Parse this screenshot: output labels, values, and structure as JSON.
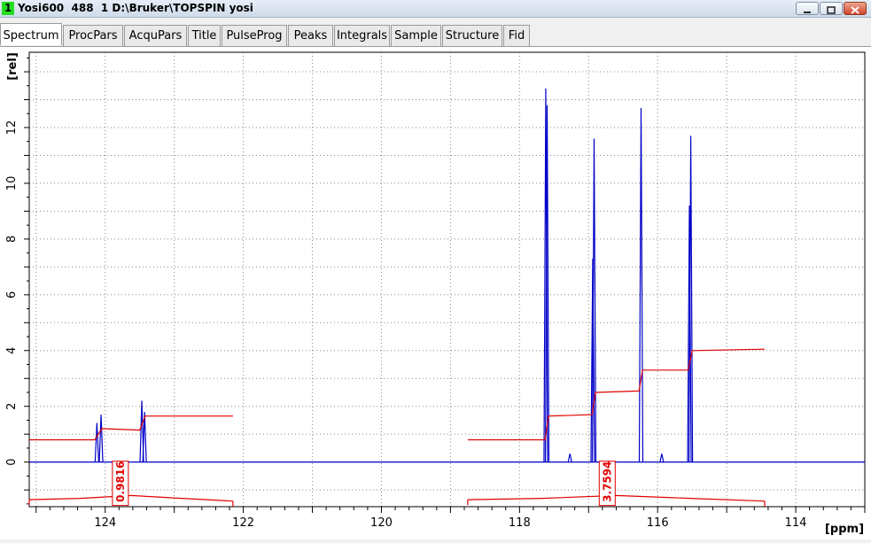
{
  "window": {
    "number": "1",
    "title": "Yosi600  488  1 D:\\Bruker\\TOPSPIN yosi"
  },
  "tabs": [
    {
      "label": "Spectrum",
      "active": true
    },
    {
      "label": "ProcPars",
      "active": false
    },
    {
      "label": "AcquPars",
      "active": false
    },
    {
      "label": "Title",
      "active": false
    },
    {
      "label": "PulseProg",
      "active": false
    },
    {
      "label": "Peaks",
      "active": false
    },
    {
      "label": "Integrals",
      "active": false
    },
    {
      "label": "Sample",
      "active": false
    },
    {
      "label": "Structure",
      "active": false
    },
    {
      "label": "Fid",
      "active": false
    }
  ],
  "colors": {
    "spectrum": "#0000c8",
    "integral": "#e00000",
    "grid": "#888888"
  },
  "chart_data": {
    "type": "line",
    "xlabel": "[ppm]",
    "ylabel": "[rel]",
    "x_reversed": true,
    "xlim": [
      125.1,
      113.0
    ],
    "ylim": [
      -1.6,
      14.7
    ],
    "x_ticks": [
      124,
      122,
      120,
      118,
      116,
      114
    ],
    "y_ticks": [
      0,
      2,
      4,
      6,
      8,
      10,
      12
    ],
    "grid": true,
    "series": [
      {
        "peaks": [
          {
            "ppm": 124.12,
            "height": 1.4
          },
          {
            "ppm": 124.06,
            "height": 1.7
          },
          {
            "ppm": 123.47,
            "height": 2.2
          },
          {
            "ppm": 123.43,
            "height": 1.8
          },
          {
            "ppm": 117.62,
            "height": 13.4
          },
          {
            "ppm": 117.6,
            "height": 12.8
          },
          {
            "ppm": 117.27,
            "height": 0.3
          },
          {
            "ppm": 116.92,
            "height": 11.6
          },
          {
            "ppm": 116.94,
            "height": 7.3
          },
          {
            "ppm": 116.24,
            "height": 12.7
          },
          {
            "ppm": 115.94,
            "height": 0.3
          },
          {
            "ppm": 115.52,
            "height": 11.7
          },
          {
            "ppm": 115.54,
            "height": 9.2
          }
        ]
      }
    ],
    "integral_regions": [
      {
        "label": "0.9816",
        "label_ppm": 123.78,
        "x_start": 125.1,
        "x_end": 122.15,
        "curve": [
          [
            125.1,
            0.8
          ],
          [
            124.15,
            0.8
          ],
          [
            124.05,
            1.2
          ],
          [
            123.5,
            1.15
          ],
          [
            123.42,
            1.65
          ],
          [
            122.15,
            1.65
          ]
        ],
        "bracket": [
          -1.35,
          -1.3,
          -1.2,
          -1.3,
          -1.4
        ]
      },
      {
        "label": "3.7594",
        "label_ppm": 116.73,
        "x_start": 118.75,
        "x_end": 114.45,
        "curve": [
          [
            118.75,
            0.8
          ],
          [
            117.63,
            0.8
          ],
          [
            117.58,
            1.65
          ],
          [
            116.95,
            1.7
          ],
          [
            116.9,
            2.5
          ],
          [
            116.27,
            2.55
          ],
          [
            116.22,
            3.3
          ],
          [
            115.56,
            3.3
          ],
          [
            115.5,
            4.0
          ],
          [
            114.45,
            4.05
          ]
        ],
        "bracket": [
          -1.35,
          -1.3,
          -1.2,
          -1.3,
          -1.4
        ]
      }
    ]
  }
}
